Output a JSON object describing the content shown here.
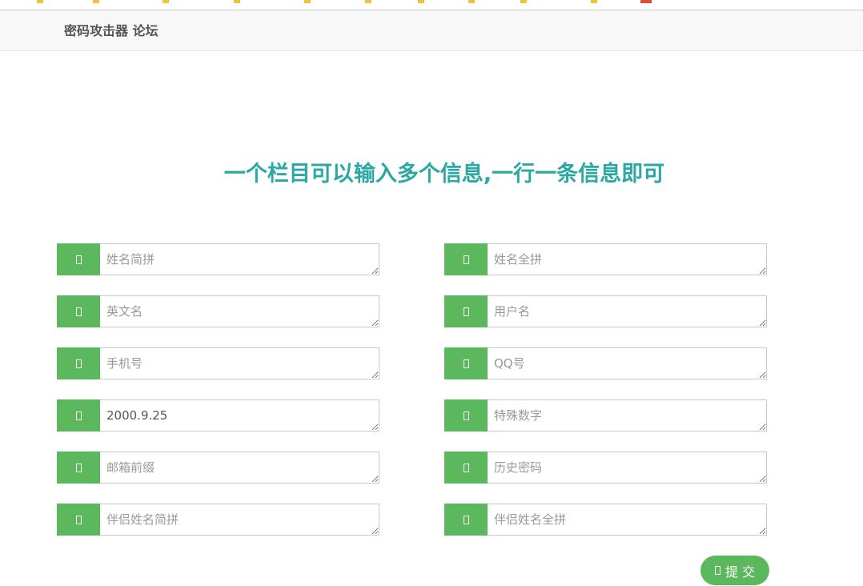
{
  "header": {
    "brand": "密码攻击器 论坛"
  },
  "headline": "一个栏目可以输入多个信息,一行一条信息即可",
  "fields": [
    {
      "placeholder": "姓名简拼",
      "value": ""
    },
    {
      "placeholder": "姓名全拼",
      "value": ""
    },
    {
      "placeholder": "英文名",
      "value": ""
    },
    {
      "placeholder": "用户名",
      "value": ""
    },
    {
      "placeholder": "手机号",
      "value": ""
    },
    {
      "placeholder": "QQ号",
      "value": ""
    },
    {
      "placeholder": "",
      "value": "2000.9.25"
    },
    {
      "placeholder": "特殊数字",
      "value": ""
    },
    {
      "placeholder": "邮箱前缀",
      "value": ""
    },
    {
      "placeholder": "历史密码",
      "value": ""
    },
    {
      "placeholder": "伴侣姓名简拼",
      "value": ""
    },
    {
      "placeholder": "伴侣姓名全拼",
      "value": ""
    }
  ],
  "submit": {
    "label": "提 交"
  },
  "colors": {
    "accent_green": "#5cb85c",
    "headline_teal": "#2ba8a3"
  }
}
